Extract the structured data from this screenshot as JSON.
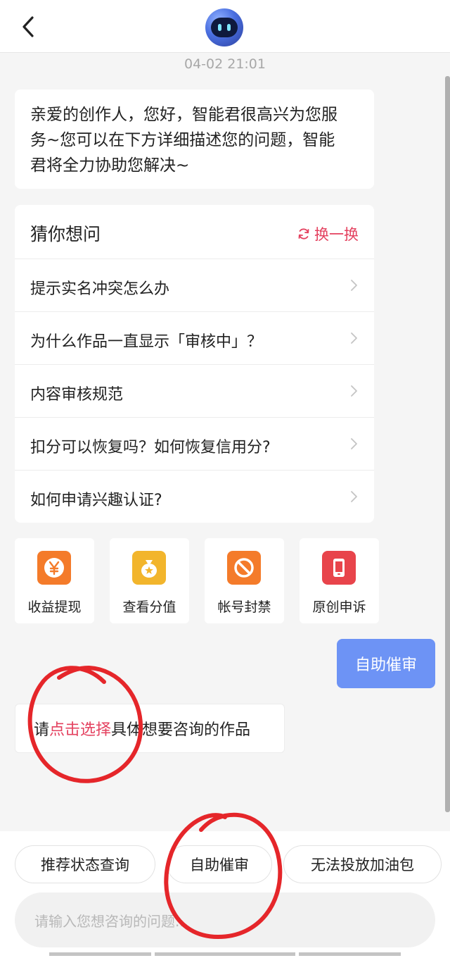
{
  "header": {
    "back_icon": "chevron-left-icon",
    "avatar_icon": "robot-avatar-icon"
  },
  "timestamp": "04-02 21:01",
  "greeting": {
    "line1": "亲爱的创作人，您好，智能君很高兴为您服",
    "line2": "务~您可以在下方详细描述您的问题，智能",
    "line3": "君将全力协助您解决~"
  },
  "faq": {
    "title": "猜你想问",
    "refresh_label": "换一换",
    "items": [
      {
        "label": "提示实名冲突怎么办"
      },
      {
        "label": "为什么作品一直显示「审核中」？"
      },
      {
        "label": "内容审核规范"
      },
      {
        "label": "扣分可以恢复吗？如何恢复信用分?"
      },
      {
        "label": "如何申请兴趣认证?"
      }
    ]
  },
  "tiles": [
    {
      "label": "收益提现",
      "icon": "yen-icon",
      "color": "#f47b2a"
    },
    {
      "label": "查看分值",
      "icon": "money-bag-icon",
      "color": "#f2b52c"
    },
    {
      "label": "帐号封禁",
      "icon": "ban-icon",
      "color": "#f47b2a"
    },
    {
      "label": "原创申诉",
      "icon": "phone-icon",
      "color": "#e8444b"
    }
  ],
  "user_message": "自助催审",
  "select_prompt": {
    "prefix": "请",
    "link": "点击选择",
    "suffix": "具体想要咨询的作品"
  },
  "chips": [
    {
      "label": "推荐状态查询"
    },
    {
      "label": "自助催审"
    },
    {
      "label": "无法投放加油包"
    }
  ],
  "input": {
    "placeholder": "请输入您想咨询的问题..."
  },
  "colors": {
    "accent": "#e4415f",
    "user_bubble": "#6d93f5",
    "annotation": "#e5262a"
  }
}
